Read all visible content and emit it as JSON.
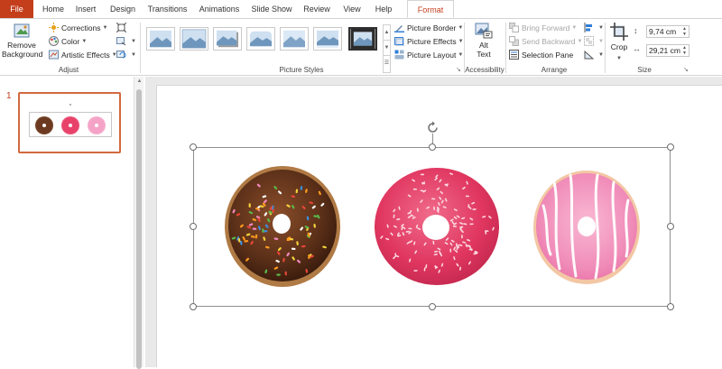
{
  "tabs": [
    {
      "label": "File",
      "x": 0
    },
    {
      "label": "Home"
    },
    {
      "label": "Insert"
    },
    {
      "label": "Design"
    },
    {
      "label": "Transitions"
    },
    {
      "label": "Animations"
    },
    {
      "label": "Slide Show"
    },
    {
      "label": "Review"
    },
    {
      "label": "View"
    },
    {
      "label": "Help"
    },
    {
      "label": "Format"
    }
  ],
  "ribbon": {
    "adjust": {
      "remove_background": "Remove Background",
      "corrections": "Corrections",
      "color": "Color",
      "artistic_effects": "Artistic Effects",
      "group_label": "Adjust"
    },
    "picture_styles": {
      "group_label": "Picture Styles",
      "picture_border": "Picture Border",
      "picture_effects": "Picture Effects",
      "picture_layout": "Picture Layout"
    },
    "accessibility": {
      "alt_text": "Alt Text",
      "group_label": "Accessibility"
    },
    "arrange": {
      "bring_forward": "Bring Forward",
      "send_backward": "Send Backward",
      "selection_pane": "Selection Pane",
      "group_label": "Arrange"
    },
    "size": {
      "crop": "Crop",
      "height": "9,74 cm",
      "width": "29,21 cm",
      "group_label": "Size"
    }
  },
  "slides_pane": {
    "slide_number": "1"
  },
  "colors": {
    "accent": "#c43e1c",
    "thumb_border": "#d2693f",
    "chocolate": "#6b3a21",
    "pink_glaze": "#e8426a",
    "light_pink": "#f4a3c6"
  }
}
